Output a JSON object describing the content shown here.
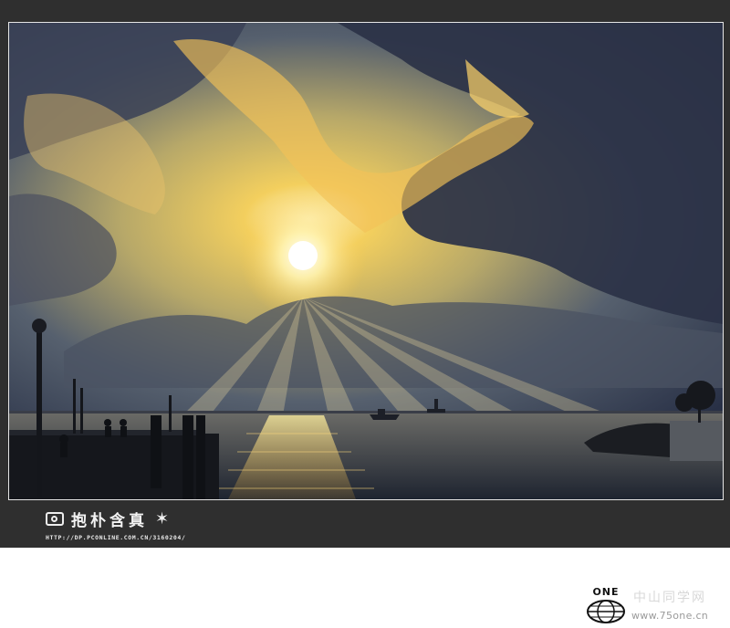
{
  "photo": {
    "subject": "sunset-over-harbor-with-pier-and-statue"
  },
  "signature": {
    "text": "抱朴含真",
    "icon": "camera-icon",
    "star_icon": "star-burst-icon",
    "url": "HTTP://DP.PCONLINE.COM.CN/3160204/"
  },
  "watermark": {
    "logo_text": "ONE",
    "cn_text": "中山同学网",
    "url": "www.75one.cn"
  },
  "colors": {
    "frame": "#2f2f2f",
    "sky_gold": "#f0c24a",
    "cloud_dark": "#2c3346",
    "water": "#3b4452"
  }
}
